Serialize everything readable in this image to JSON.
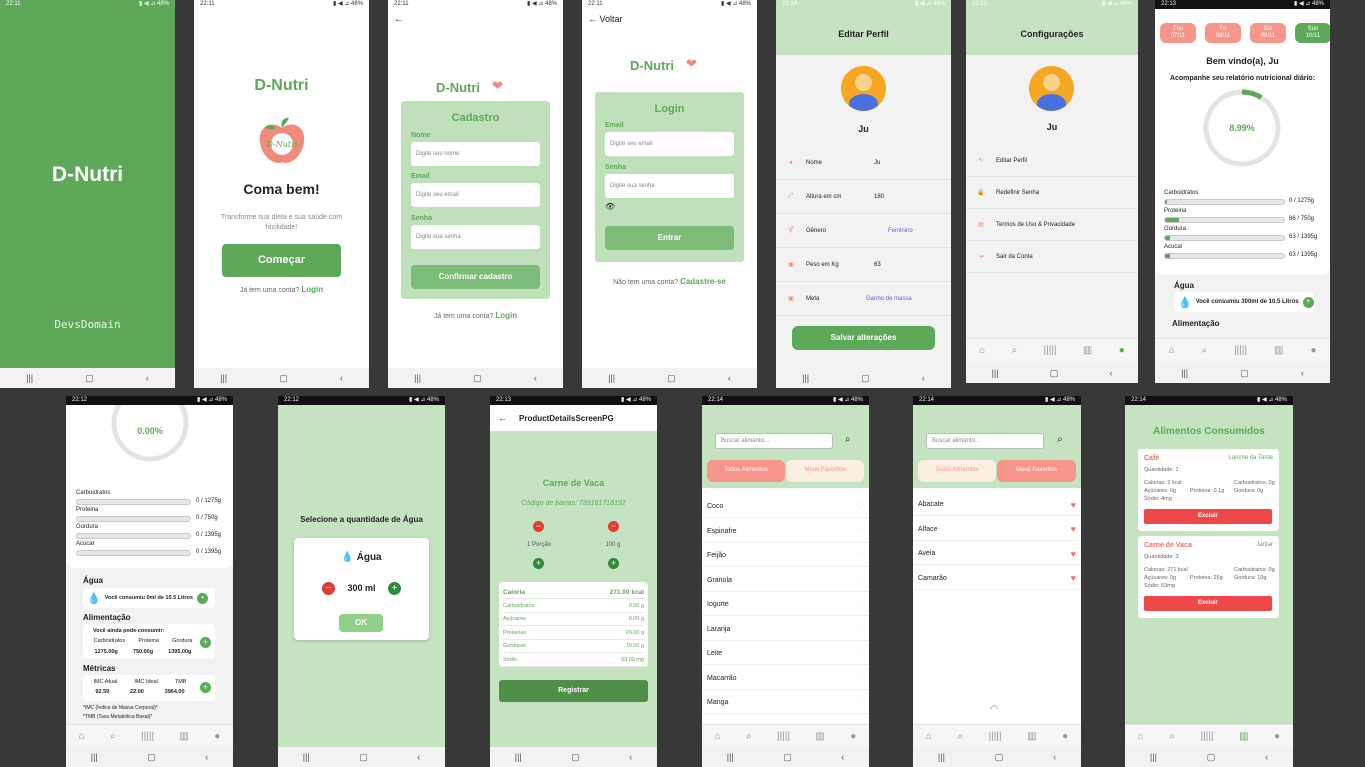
{
  "status": {
    "t1": "22:11",
    "t2": "22:12",
    "t3": "22:13",
    "t4": "22:14",
    "icons": "▮ ◀ ⊿ 48%"
  },
  "splash": {
    "title": "D-Nutri",
    "footer": "DevsDomain"
  },
  "welcome": {
    "brand": "D-Nutri",
    "logo_text": "D-Nutri",
    "headline": "Coma bem!",
    "sub": "Transforme sua dieta e sua saúde com facilidade!",
    "cta": "Começar",
    "have_account": "Já tem uma conta?",
    "login": "Login"
  },
  "signup": {
    "brand": "D-Nutri",
    "title": "Cadastro",
    "name_lbl": "Nome",
    "name_ph": "Digite seu nome",
    "email_lbl": "Email",
    "email_ph": "Digite seu email",
    "pass_lbl": "Senha",
    "pass_ph": "Digite sua senha",
    "confirm": "Confirmar cadastro",
    "have_account": "Já tem uma conta?",
    "login": "Login"
  },
  "login": {
    "back": "Voltar",
    "brand": "D-Nutri",
    "title": "Login",
    "email_lbl": "Email",
    "email_ph": "Digite seu email",
    "pass_lbl": "Senha",
    "pass_ph": "Digite sua senha",
    "enter": "Entrar",
    "no_account": "Não tem uma conta?",
    "signup": "Cadastre-se"
  },
  "edit": {
    "title": "Editar Perfil",
    "user": "Ju",
    "rows": [
      {
        "k": "Nome",
        "v": "Ju"
      },
      {
        "k": "Altura em cm",
        "v": "180"
      },
      {
        "k": "Gênero",
        "v": "Feminino"
      },
      {
        "k": "Peso em Kg",
        "v": "63"
      },
      {
        "k": "Meta",
        "v": "Ganho de massa"
      }
    ],
    "save": "Salvar alterações"
  },
  "settings": {
    "title": "Configurações",
    "user": "Ju",
    "items": [
      "Editar Perfil",
      "Redefinir Senha",
      "Termos de Uso & Privacidade",
      "Sair da Conta"
    ]
  },
  "home": {
    "days": [
      {
        "d": "Thu",
        "n": "07/11"
      },
      {
        "d": "Fri",
        "n": "08/11"
      },
      {
        "d": "Sat",
        "n": "09/11"
      },
      {
        "d": "Sun",
        "n": "10/11"
      }
    ],
    "welcome": "Bem vindo(a), Ju",
    "report": "Acompanhe seu relatório nutricional diário:",
    "percent": "8.99%",
    "percent_value": 0.0899,
    "macros": [
      {
        "n": "Carboidratos",
        "v": "0 / 1275g",
        "p": 0
      },
      {
        "n": "Proteina",
        "v": "86 / 750g",
        "p": 0.115
      },
      {
        "n": "Gordura",
        "v": "63 / 1395g",
        "p": 0.045
      },
      {
        "n": "Acucar",
        "v": "63 / 1395g",
        "p": 0.045
      }
    ],
    "water_title": "Água",
    "water_text": "Você consumiu 300ml de 10.5 Litros",
    "food_title": "Alimentação"
  },
  "home2": {
    "percent": "0.00%",
    "macros": [
      {
        "n": "Carboidratos",
        "v": "0 / 1275g"
      },
      {
        "n": "Proteina",
        "v": "0 / 750g"
      },
      {
        "n": "Gordura",
        "v": "0 / 1395g"
      },
      {
        "n": "Acucar",
        "v": "0 / 1395g"
      }
    ],
    "water_title": "Água",
    "water_text": "Você consumiu 0ml de 10.5 Litros",
    "food_title": "Alimentação",
    "can_consume": "Você ainda pode consumir:",
    "food_heads": [
      "Carboidratos",
      "Proteina",
      "Gordura"
    ],
    "food_vals": [
      "1275.00g",
      "750.00g",
      "1395.00g"
    ],
    "metrics_title": "Métricas",
    "metric_heads": [
      "IMC Atual",
      "IMC Ideal",
      "TMB"
    ],
    "metric_vals": [
      "92.59",
      "22.00",
      "3964.00"
    ],
    "note1": "*IMC (Índice de Massa Corporal)*",
    "note2": "*TMB (Taxa Metabólica Basal)*"
  },
  "water": {
    "title": "Selecione a quantidade de Água",
    "label": "Água",
    "amount": "300 ml",
    "ok": "OK"
  },
  "product": {
    "header": "ProductDetailsScreenPG",
    "name": "Carne de Vaca",
    "barcode": "Código de barras: 789161718192",
    "portion": "1 Porção",
    "grams": "100 g",
    "table": [
      {
        "k": "Caloria",
        "v": "271.00 kcal"
      },
      {
        "k": "Carboidratos",
        "v": "0.00 g"
      },
      {
        "k": "Açúcares",
        "v": "0.00 g"
      },
      {
        "k": "Proteinas",
        "v": "26.00 g"
      },
      {
        "k": "Gorduras",
        "v": "19.00 g"
      },
      {
        "k": "Sódio",
        "v": "63.00 mg"
      }
    ],
    "register": "Registrar"
  },
  "search": {
    "placeholder": "Buscar alimento...",
    "tab_all": "Todos Alimentos",
    "tab_fav": "Meus Favoritos",
    "items": [
      "Coco",
      "Espinafre",
      "Feijão",
      "Granola",
      "Iogurte",
      "Laranja",
      "Leite",
      "Macarrão",
      "Manga"
    ]
  },
  "favs": {
    "placeholder": "Buscar alimento...",
    "tab_all": "Todos Alimentos",
    "tab_fav": "Meus Favoritos",
    "items": [
      "Abacate",
      "Alface",
      "Aveia",
      "Camarão"
    ]
  },
  "consumed": {
    "title": "Alimentos Consumidos",
    "cards": [
      {
        "name": "Café",
        "meal": "Lanche da Tarde",
        "qty": "Quantidade: 1",
        "l1a": "Calorias: 2 kcal",
        "l1b": "Carboidratos: 0g",
        "l2a": "Açúcares: 0g",
        "l2b": "Proteina: 0.1g",
        "l2c": "Gordura: 0g",
        "l3": "Sódio: 4mg",
        "btn": "Excluir"
      },
      {
        "name": "Carne de Vaca",
        "meal": "Jantar",
        "qty": "Quantidade: 3",
        "l1a": "Calorias: 271 kcal",
        "l1b": "Carboidratos: 0g",
        "l2a": "Açúcares: 0g",
        "l2b": "Proteina: 26g",
        "l2c": "Gordura: 19g",
        "l3": "Sódio: 63mg",
        "btn": "Excluir"
      }
    ]
  },
  "colors": {
    "green": "#5ea85a",
    "light_green": "#c5e3c1",
    "salmon": "#f7958a",
    "red": "#f04848"
  }
}
